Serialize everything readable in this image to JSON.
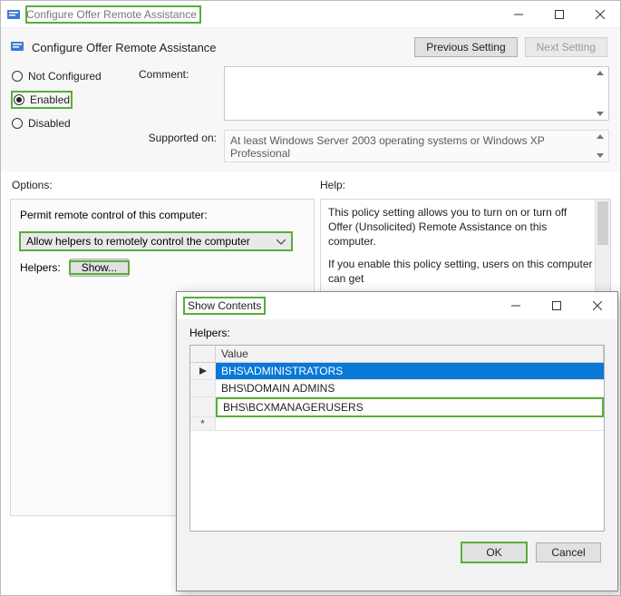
{
  "window": {
    "title": "Configure Offer Remote Assistance",
    "policy_title": "Configure Offer Remote Assistance",
    "nav": {
      "prev": "Previous Setting",
      "next": "Next Setting"
    },
    "radios": {
      "not_configured": "Not Configured",
      "enabled": "Enabled",
      "disabled": "Disabled"
    },
    "comment_label": "Comment:",
    "comment_value": "",
    "supported_label": "Supported on:",
    "supported_value": "At least Windows Server 2003 operating systems or Windows XP Professional",
    "options_label": "Options:",
    "help_label": "Help:",
    "options": {
      "permit_label": "Permit remote control of this computer:",
      "permit_value": "Allow helpers to remotely control the computer",
      "helpers_label": "Helpers:",
      "show_btn": "Show..."
    },
    "help_text_1": "This policy setting allows you to turn on or turn off Offer (Unsolicited) Remote Assistance on this computer.",
    "help_text_2": "If you enable this policy setting, users on this computer can get"
  },
  "dialog": {
    "title": "Show Contents",
    "list_label": "Helpers:",
    "col_value": "Value",
    "rows": [
      "BHS\\ADMINISTRATORS",
      "BHS\\DOMAIN ADMINS",
      "BHS\\BCXMANAGERUSERS"
    ],
    "ok": "OK",
    "cancel": "Cancel"
  }
}
